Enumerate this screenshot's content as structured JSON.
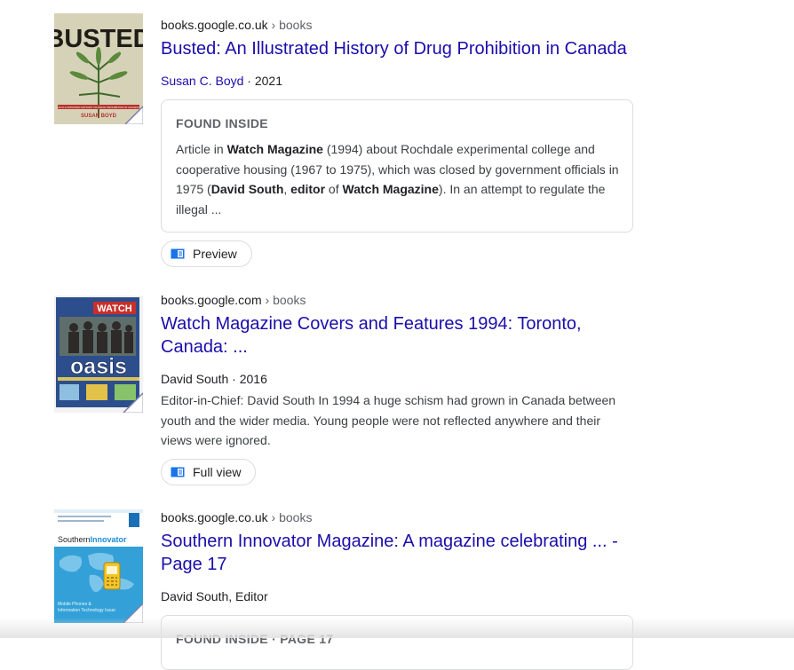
{
  "results": [
    {
      "domain": "books.google.co.uk",
      "crumb": "› books",
      "title": "Busted: An Illustrated History of Drug Prohibition in Canada",
      "author": "Susan C. Boyd",
      "year": "· 2021",
      "found_label": "FOUND INSIDE",
      "snippet_parts": [
        {
          "t": "Article in ",
          "b": false
        },
        {
          "t": "Watch Magazine",
          "b": true
        },
        {
          "t": " (1994) about Rochdale experimental college and cooperative housing (1967 to 1975), which was closed by government officials in 1975 (",
          "b": false
        },
        {
          "t": "David South",
          "b": true
        },
        {
          "t": ", ",
          "b": false
        },
        {
          "t": "editor",
          "b": true
        },
        {
          "t": " of ",
          "b": false
        },
        {
          "t": "Watch Magazine",
          "b": true
        },
        {
          "t": "). In an attempt to regulate the illegal ...",
          "b": false
        }
      ],
      "button": "Preview",
      "cover": {
        "headline": "BUSTED",
        "tagline": "AN ILLUSTRATED HISTORY OF DRUG PROHIBITION IN CANADA",
        "author": "SUSAN BOYD"
      }
    },
    {
      "domain": "books.google.com",
      "crumb": "› books",
      "title": "Watch Magazine Covers and Features 1994: Toronto, Canada: ...",
      "author": "David South",
      "year": "· 2016",
      "snippet": "Editor-in-Chief: David South In 1994 a huge schism had grown in Canada between youth and the wider media. Young people were not reflected anywhere and their views were ignored.",
      "button": "Full view",
      "cover": {
        "masthead": "WATCH",
        "cover_line": "oasis"
      }
    },
    {
      "domain": "books.google.co.uk",
      "crumb": "› books",
      "title": "Southern Innovator Magazine: A magazine celebrating ... - Page 17",
      "author": "David South, Editor",
      "found_label": "FOUND INSIDE · PAGE 17",
      "cover": {
        "brand_1": "Southern",
        "brand_2": "Innovator",
        "subtitle_1": "Mobile Phones &",
        "subtitle_2": "Information Technology Issue"
      }
    }
  ],
  "colors": {
    "link": "#1a0dab",
    "text": "#202124",
    "secondary": "#5f6368",
    "border": "#dadce0",
    "book_icon": "#1a73e8"
  },
  "icons": {
    "button_icon": "book-icon"
  }
}
